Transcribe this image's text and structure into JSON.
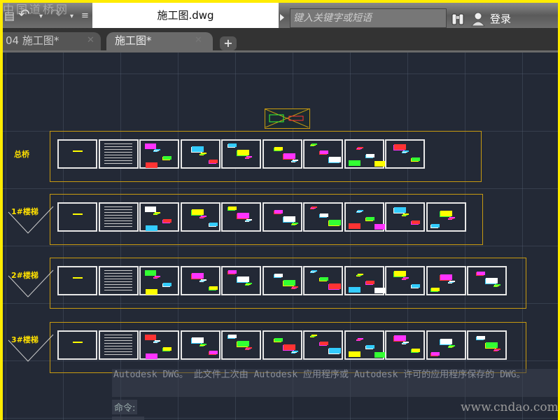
{
  "watermark": "中国道桥网",
  "title": "施工图.dwg",
  "search": {
    "placeholder": "键入关键字或短语"
  },
  "login": "登录",
  "tabs": [
    {
      "label": "04 施工图*",
      "close": "✕"
    },
    {
      "label": "施工图*",
      "close": "✕"
    }
  ],
  "tab_add": "+",
  "groups": [
    {
      "label": "总桥",
      "sheets": 9
    },
    {
      "label": "1#楼梯",
      "sheets": 10
    },
    {
      "label": "2#楼梯",
      "sheets": 11
    },
    {
      "label": "3#楼梯",
      "sheets": 11
    }
  ],
  "command": {
    "message": "Autodesk DWG。  此文件上次由 Autodesk 应用程序或 Autodesk 许可的应用程序保存的 DWG。",
    "prompt": "命令:"
  },
  "site": "www.cndao.com",
  "colors": {
    "frame": "#c89a10",
    "background": "#232936",
    "border": "#ffec00"
  }
}
